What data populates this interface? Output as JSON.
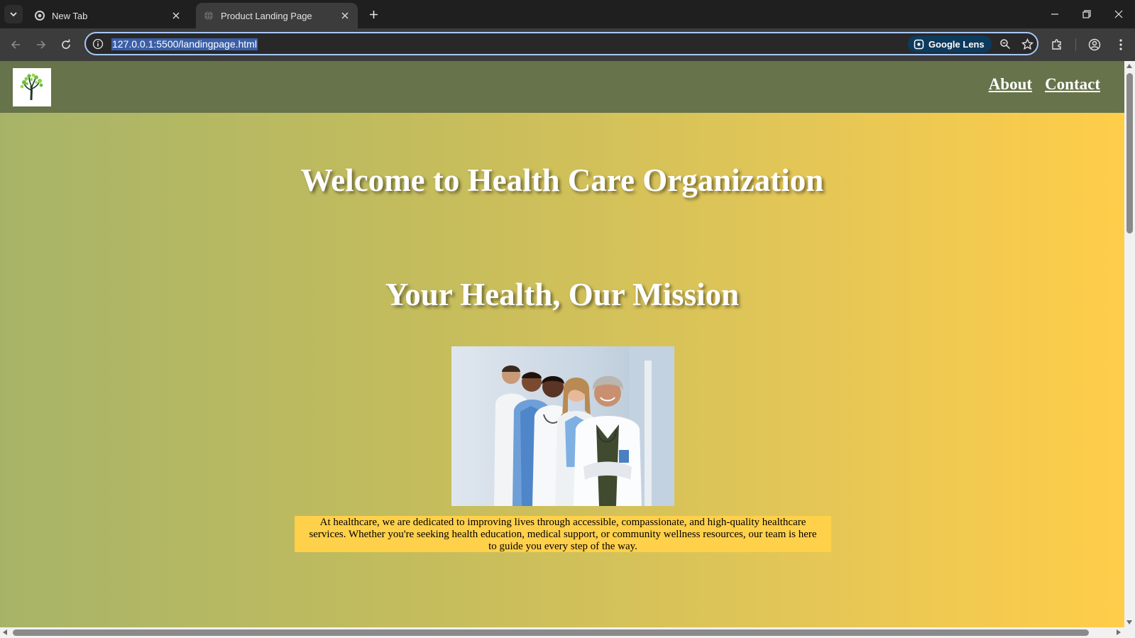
{
  "browser": {
    "tabs": [
      {
        "title": "New Tab",
        "active": false,
        "icon": "chrome-icon"
      },
      {
        "title": "Product Landing Page",
        "active": true,
        "icon": "globe-icon"
      }
    ],
    "url": "127.0.0.1:5500/landingpage.html",
    "lens_label": "Google Lens"
  },
  "site": {
    "nav": {
      "about": "About",
      "contact": "Contact"
    },
    "hero_title": "Welcome to Health Care Organization",
    "mission_title": "Your Health, Our Mission",
    "intro_text": "At healthcare, we are dedicated to improving lives through accessible, compassionate, and high-quality healthcare services. Whether you're seeking health education, medical support, or community wellness resources, our team is here to guide you every step of the way."
  },
  "colors": {
    "header": "#67734a",
    "gradient_start": "#a7b468",
    "gradient_end": "#ffcd49",
    "intro_box": "#ffd04a"
  }
}
